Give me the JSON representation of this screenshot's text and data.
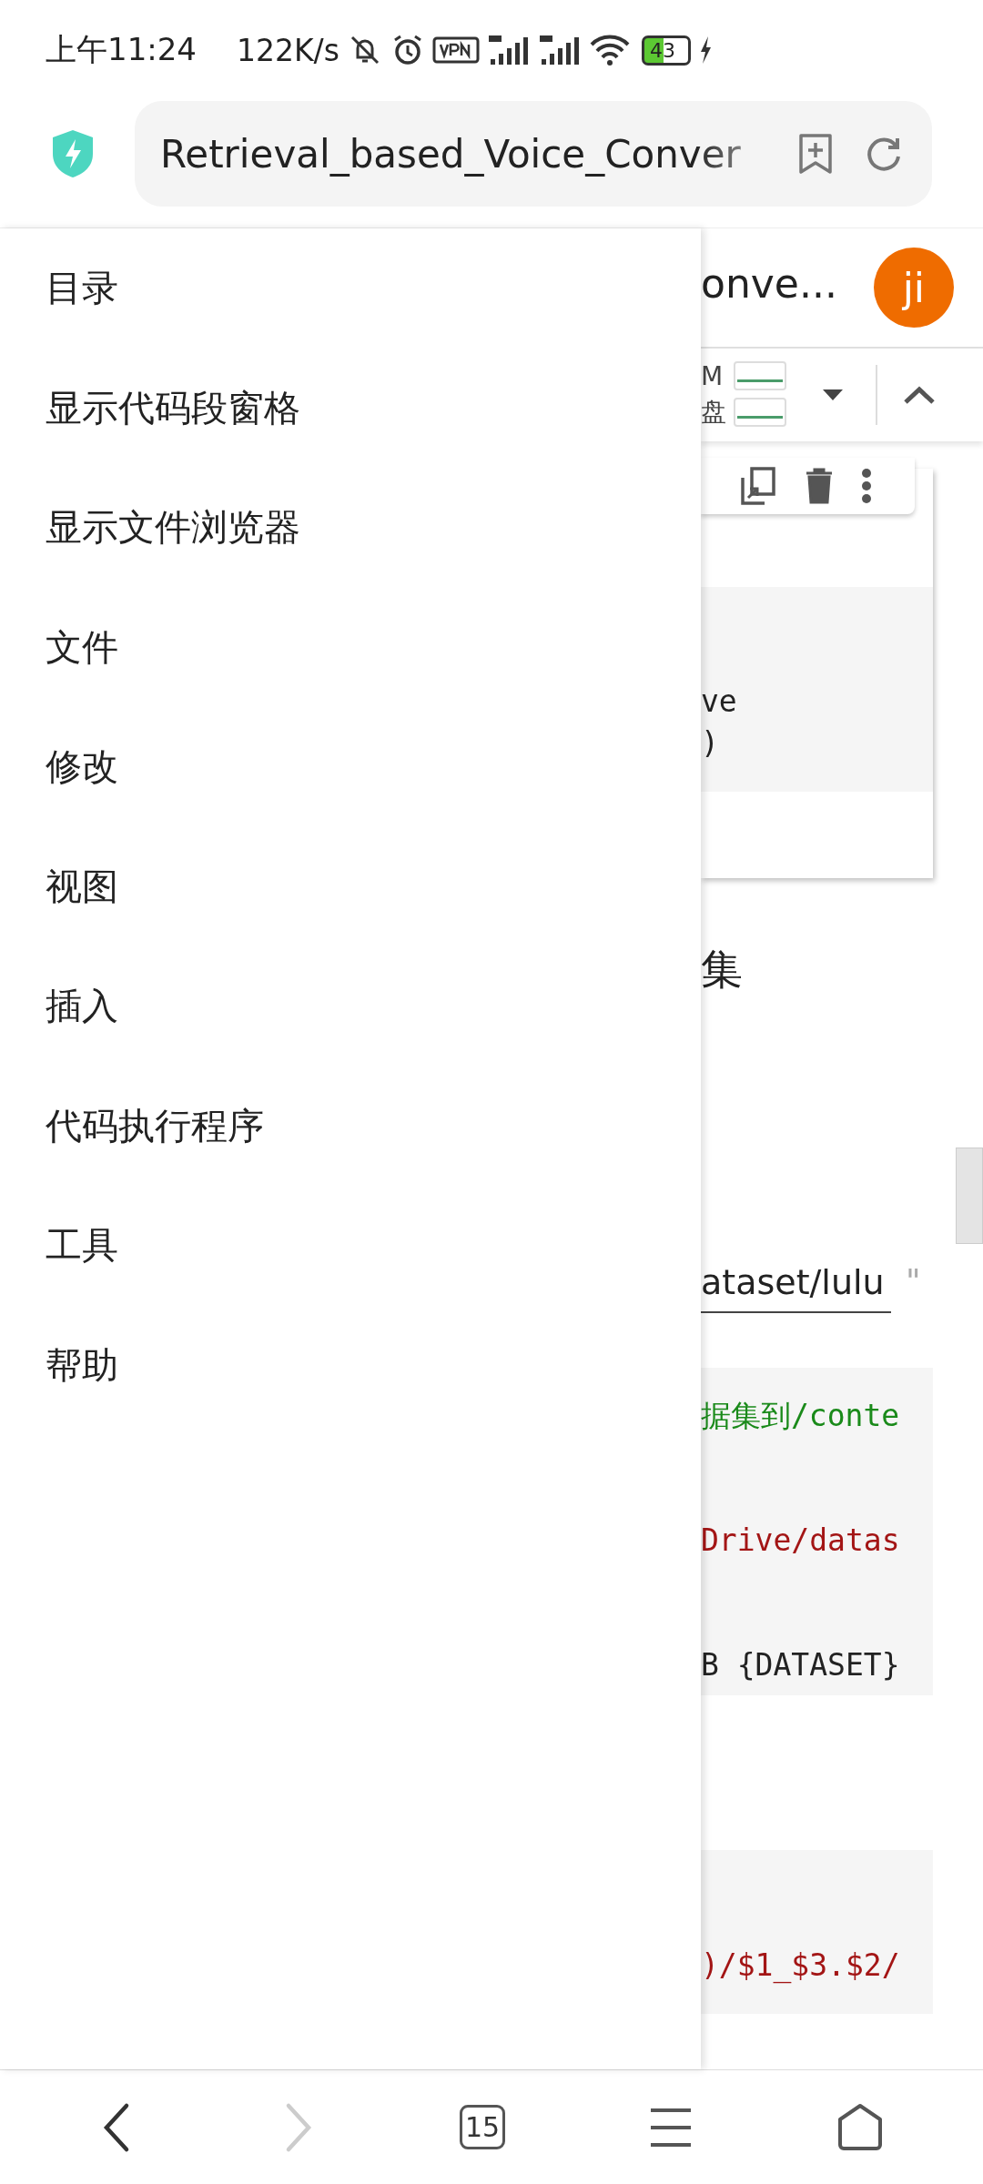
{
  "status_bar": {
    "time": "上午11:24",
    "speed": "122K/s",
    "battery": "43"
  },
  "address_bar": {
    "url": "Retrieval_based_Voice_Conver"
  },
  "drawer": {
    "items": [
      "目录",
      "显示代码段窗格",
      "显示文件浏览器",
      "文件",
      "修改",
      "视图",
      "插入",
      "代码执行程序",
      "工具",
      "帮助"
    ]
  },
  "notebook": {
    "title": "onve...",
    "avatar": "ji",
    "resources": [
      "M",
      "盘"
    ],
    "cell_lines": [
      "ve",
      ")"
    ],
    "heading": "集",
    "field": {
      "value": "ataset/lulu",
      "quote": "\""
    },
    "code_blocks": [
      {
        "lines": [
          {
            "kind": "comment",
            "text": "据集到/conte"
          },
          {
            "kind": "string",
            "text": "Drive/datas"
          },
          {
            "kind": "plain",
            "text": "B {DATASET}"
          }
        ]
      },
      {
        "lines": [
          {
            "kind": "string",
            "text": ")/$1_$3.$2/"
          }
        ]
      }
    ]
  },
  "bottom_nav": {
    "tab_count": "15",
    "back_disabled": false,
    "forward_disabled": true
  }
}
